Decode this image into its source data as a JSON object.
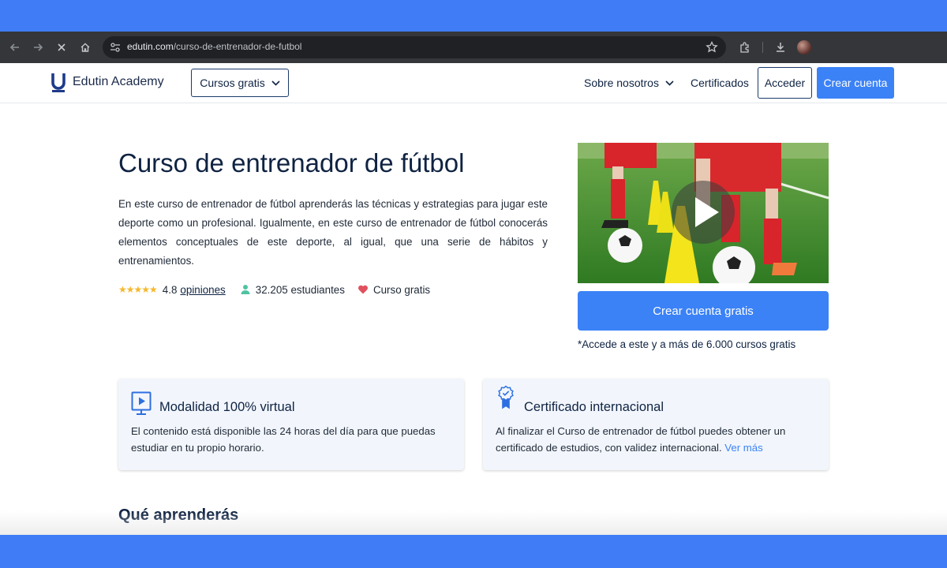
{
  "browser": {
    "url_domain": "edutin.com",
    "url_path": "/curso-de-entrenador-de-futbol",
    "icons": [
      "back-icon",
      "forward-icon",
      "stop-icon",
      "home-icon",
      "site-settings-icon",
      "bookmark-star-icon",
      "extensions-icon",
      "download-icon",
      "profile-avatar"
    ]
  },
  "header": {
    "logo_text": "Edutin Academy",
    "courses_label": "Cursos gratis",
    "about_label": "Sobre nosotros",
    "certificates_label": "Certificados",
    "login_label": "Acceder",
    "signup_label": "Crear cuenta"
  },
  "hero": {
    "title": "Curso de entrenador de fútbol",
    "description": "En este curso de entrenador de fútbol aprenderás las técnicas y estrategias para jugar este deporte como un profesional. Igualmente, en este curso de entrenador de fútbol conocerás elementos conceptuales de este deporte, al igual, que una serie de hábitos y entrenamientos.",
    "stars": "★★★★★",
    "rating": "4.8",
    "reviews_label": "opiniones",
    "students": "32.205 estudiantes",
    "free_label": "Curso gratis",
    "cta_label": "Crear cuenta gratis",
    "cta_note": "*Accede a este y a más de 6.000 cursos gratis"
  },
  "features": [
    {
      "title": "Modalidad 100% virtual",
      "text": "El contenido está disponible las 24 horas del día para que puedas estudiar en tu propio horario.",
      "link": ""
    },
    {
      "title": "Certificado internacional",
      "text": "Al finalizar el Curso de entrenador de fútbol puedes obtener un certificado de estudios, con validez internacional. ",
      "link": "Ver más"
    }
  ],
  "section": {
    "learn_title": "Qué aprenderás"
  },
  "colors": {
    "page_background": "#3f7cf6",
    "primary": "#3b82f6",
    "navy": "#0f2342",
    "star": "#f5b82e",
    "card_background": "#f2f6fc"
  }
}
